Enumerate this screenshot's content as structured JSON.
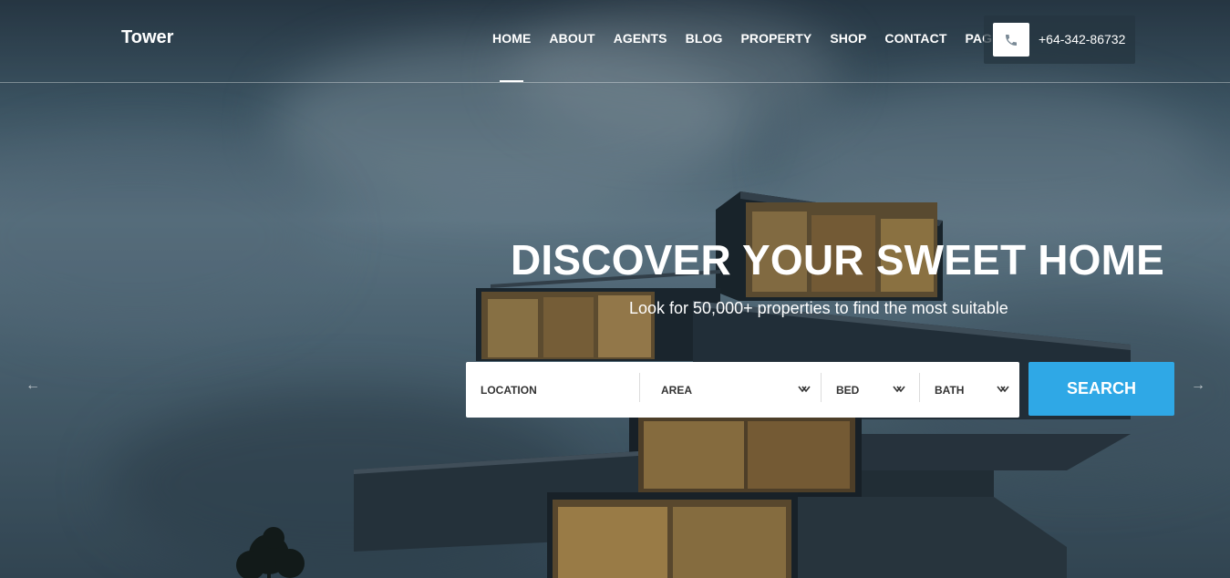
{
  "header": {
    "logo": "Tower",
    "nav": [
      "HOME",
      "ABOUT",
      "AGENTS",
      "BLOG",
      "PROPERTY",
      "SHOP",
      "CONTACT",
      "PAGES"
    ],
    "active_nav": "HOME",
    "phone": "+64-342-86732",
    "phone_icon": "phone-icon"
  },
  "hero": {
    "title": "DISCOVER YOUR SWEET HOME",
    "subtitle": "Look for 50,000+ properties to find the most suitable"
  },
  "search": {
    "location_label": "LOCATION",
    "area_label": "AREA",
    "bed_label": "BED",
    "bath_label": "BATH",
    "button_label": "SEARCH"
  },
  "slider": {
    "prev": "←",
    "next": "→"
  },
  "colors": {
    "accent": "#2fa8e6",
    "nav_text": "#ffffff",
    "phone_box": "#263640"
  }
}
